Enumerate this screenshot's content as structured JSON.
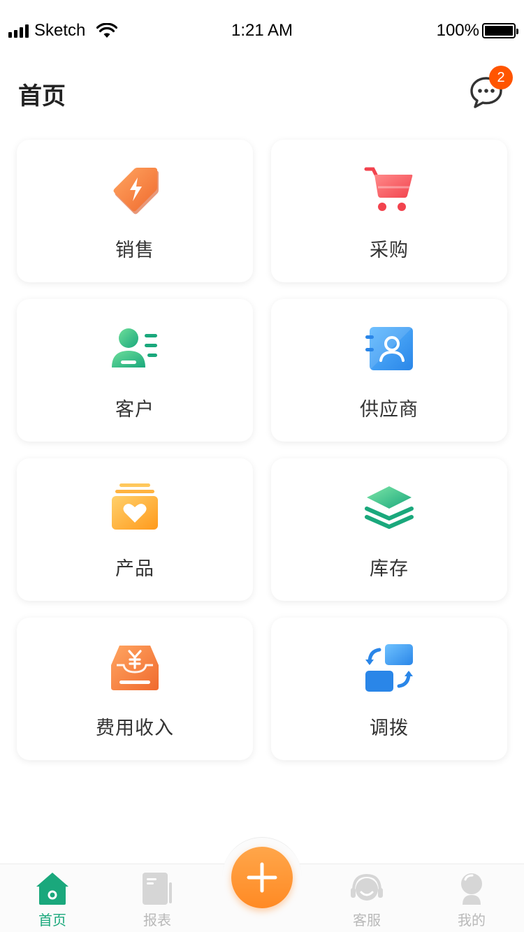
{
  "status_bar": {
    "carrier": "Sketch",
    "time": "1:21 AM",
    "battery": "100%"
  },
  "header": {
    "title": "首页",
    "message_badge": "2"
  },
  "grid": [
    {
      "label": "销售",
      "icon": "tag-lightning-icon"
    },
    {
      "label": "采购",
      "icon": "shopping-cart-icon"
    },
    {
      "label": "客户",
      "icon": "customer-card-icon"
    },
    {
      "label": "供应商",
      "icon": "supplier-contact-icon"
    },
    {
      "label": "产品",
      "icon": "product-box-heart-icon"
    },
    {
      "label": "库存",
      "icon": "stacked-layers-icon"
    },
    {
      "label": "费用收入",
      "icon": "yuan-inbox-icon"
    },
    {
      "label": "调拨",
      "icon": "transfer-icon"
    }
  ],
  "tabbar": {
    "home": "首页",
    "reports": "报表",
    "service": "客服",
    "mine": "我的"
  },
  "colors": {
    "accent": "#1aa87c",
    "fab": "#ff8a24",
    "badge": "#ff5500"
  }
}
